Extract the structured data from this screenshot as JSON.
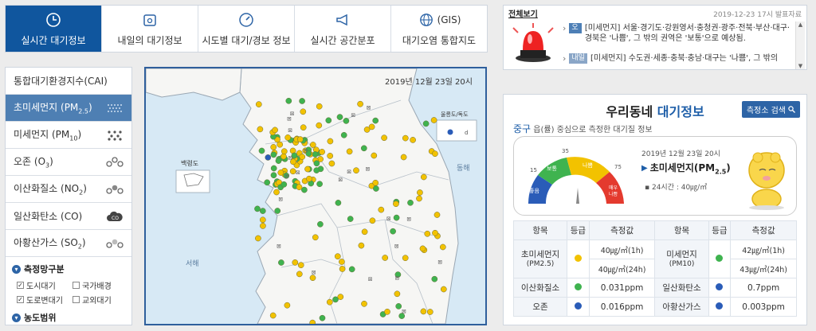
{
  "nav": {
    "tabs": [
      {
        "label": "실시간 대기정보",
        "icon": "clock-icon"
      },
      {
        "label": "내일의 대기정보",
        "icon": "calendar-icon"
      },
      {
        "label": "시도별 대기/경보 정보",
        "icon": "gauge-icon"
      },
      {
        "label": "실시간 공간분포",
        "icon": "megaphone-icon"
      },
      {
        "label": "대기오염 통합지도",
        "icon": "globe-icon",
        "top": "(GIS)"
      }
    ]
  },
  "leftmenu": {
    "items": [
      {
        "label": "통합대기환경지수(CAI)",
        "sub": ""
      },
      {
        "label": "초미세먼지 (PM",
        "sub": "2.5",
        "tail": ")"
      },
      {
        "label": "미세먼지 (PM",
        "sub": "10",
        "tail": ")"
      },
      {
        "label": "오존 (O",
        "sub": "3",
        "tail": ")"
      },
      {
        "label": "이산화질소 (NO",
        "sub": "2",
        "tail": ")"
      },
      {
        "label": "일산화탄소 (CO)",
        "sub": ""
      },
      {
        "label": "아황산가스 (SO",
        "sub": "2",
        "tail": ")"
      }
    ],
    "group_title": "측정망구분",
    "checks": [
      {
        "label": "도시대기",
        "checked": true
      },
      {
        "label": "국가배경",
        "checked": false
      },
      {
        "label": "도로변대기",
        "checked": true
      },
      {
        "label": "교외대기",
        "checked": false
      }
    ],
    "range_title": "농도범위"
  },
  "map": {
    "datetime": "2019년 12월 23일 20시",
    "labels": {
      "baengnyeong": "백령도",
      "ulleung": "울릉도/독도",
      "donghae": "동해",
      "seohae": "서해",
      "dokdo": "d"
    }
  },
  "notice": {
    "view_all": "전체보기",
    "announce": "2019-12-23 17시 발표자료",
    "today_tag": "오늘",
    "today_text": "[미세먼지] 서울·경기도·강원영서·충청권·광주·전북·부산·대구·경북은 '나쁨', 그 밖의 권역은 '보통'으로 예상됨.",
    "tomorrow_tag": "내일",
    "tomorrow_text": "[미세먼지] 수도권·세종·충북·충남·대구는 '나쁨', 그 밖의"
  },
  "air": {
    "title_a": "우리동네 ",
    "title_b": "대기정보",
    "search_btn": "측정소 검색",
    "region": "중구",
    "region_desc": " 읍(률) 중심으로 측정한 대기질 정보",
    "gauge": {
      "labels": [
        "좋음",
        "보통",
        "나쁨",
        "매우 나쁨"
      ],
      "ticks": [
        "15",
        "35",
        "75"
      ]
    },
    "date": "2019년 12월 23일 20시",
    "pollutant": "초미세먼지(PM",
    "pollutant_sub": "2.5",
    "pollutant_tail": ")",
    "avg": "24시간 : 40㎍/㎥",
    "headers": [
      "항목",
      "등급",
      "측정값",
      "항목",
      "등급",
      "측정값"
    ],
    "rows": [
      {
        "n1": "초미세먼지",
        "n1s": "(PM2.5)",
        "v1a": "40㎍/㎥(1h)",
        "v1b": "40㎍/㎥(24h)",
        "n2": "미세먼지",
        "n2s": "(PM10)",
        "v2a": "42㎍/㎥(1h)",
        "v2b": "43㎍/㎥(24h)"
      },
      {
        "n1": "이산화질소",
        "v1": "0.031ppm",
        "n2": "일산화탄소",
        "v2": "0.7ppm"
      },
      {
        "n1": "오존",
        "v1": "0.016ppm",
        "n2": "아황산가스",
        "v2": "0.003ppm"
      }
    ]
  },
  "colors": {
    "brand": "#10569e",
    "good": "#2a5cb8",
    "normal": "#3fb34f",
    "bad": "#f2c200",
    "verybad": "#e43a2e"
  }
}
